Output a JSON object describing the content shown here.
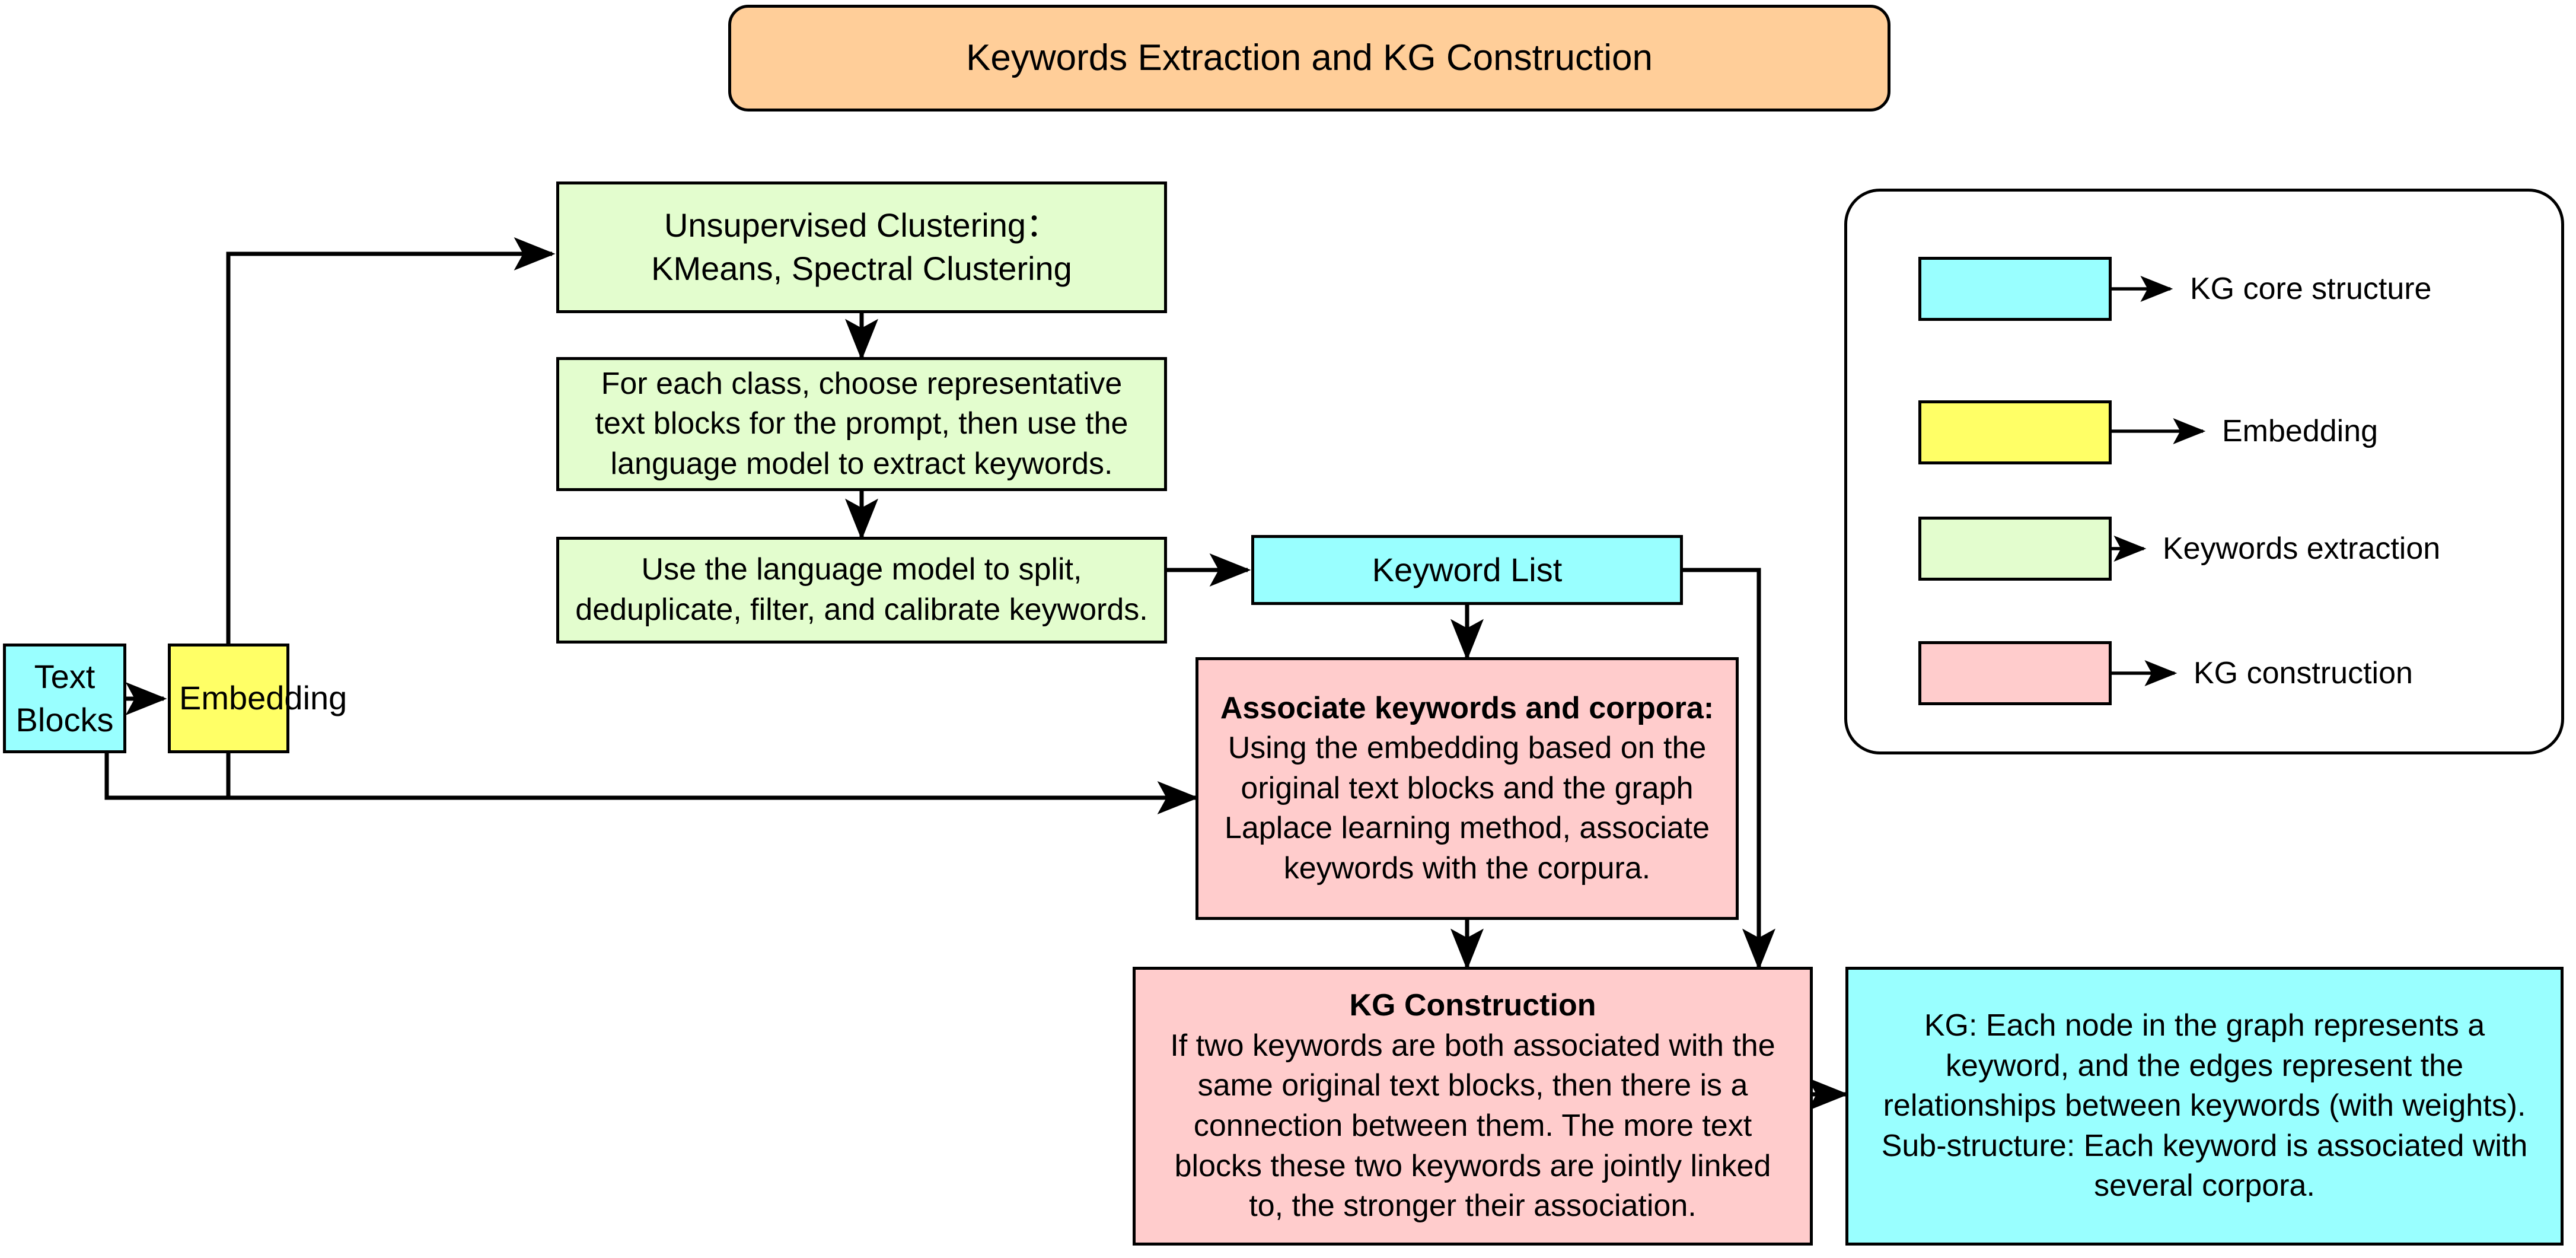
{
  "title": {
    "text": "Keywords Extraction and KG Construction"
  },
  "nodes": {
    "text_blocks": {
      "label": "Text Blocks",
      "color": "#99ffff",
      "category": "KG core structure"
    },
    "embedding": {
      "label": "Embedding",
      "color": "#ffff66",
      "category": "Embedding"
    },
    "clustering": {
      "line1": "Unsupervised Clustering：",
      "line2": "KMeans, Spectral Clustering",
      "color": "#e3fdce",
      "category": "Keywords extraction"
    },
    "representative": {
      "line1": "For each class, choose representative",
      "line2": "text blocks for the prompt, then use the",
      "line3": "language model to extract keywords.",
      "color": "#e3fdce",
      "category": "Keywords extraction"
    },
    "split_dedup": {
      "line1": "Use the language model to split,",
      "line2": "deduplicate, filter, and calibrate keywords.",
      "color": "#e3fdce",
      "category": "Keywords extraction"
    },
    "keyword_list": {
      "label": "Keyword List",
      "color": "#99ffff",
      "category": "KG core structure"
    },
    "associate": {
      "heading": "Associate keywords and corpora:",
      "line1": "Using the embedding based on the",
      "line2": "original text blocks and the graph",
      "line3": "Laplace learning method, associate",
      "line4": "keywords with the corpura.",
      "color": "#ffcccc",
      "category": "KG construction"
    },
    "kg_construction": {
      "heading": "KG Construction",
      "line1": "If two keywords are both associated with the",
      "line2": "same original text blocks, then there is a",
      "line3": "connection between them. The more text",
      "line4": "blocks these two keywords are jointly linked",
      "line5": "to, the stronger their association.",
      "color": "#ffcccc",
      "category": "KG construction"
    },
    "kg_result": {
      "line1": "KG: Each node in the graph represents a",
      "line2": "keyword, and the edges represent the",
      "line3": "relationships between keywords (with weights).",
      "line4": "Sub-structure: Each keyword is associated with",
      "line5": "several corpora.",
      "color": "#99ffff",
      "category": "KG core structure"
    }
  },
  "legend": {
    "items": [
      {
        "label": "KG core structure",
        "color": "#99ffff"
      },
      {
        "label": "Embedding",
        "color": "#ffff66"
      },
      {
        "label": "Keywords extraction",
        "color": "#e3fdce"
      },
      {
        "label": "KG construction",
        "color": "#ffcccc"
      }
    ]
  },
  "edges": [
    {
      "from": "text_blocks",
      "to": "embedding"
    },
    {
      "from": "embedding",
      "to": "clustering"
    },
    {
      "from": "clustering",
      "to": "representative"
    },
    {
      "from": "representative",
      "to": "split_dedup"
    },
    {
      "from": "split_dedup",
      "to": "keyword_list"
    },
    {
      "from": "keyword_list",
      "to": "associate"
    },
    {
      "from": "text_blocks",
      "to": "associate"
    },
    {
      "from": "embedding",
      "to": "associate"
    },
    {
      "from": "associate",
      "to": "kg_construction"
    },
    {
      "from": "keyword_list",
      "to": "kg_construction"
    },
    {
      "from": "kg_construction",
      "to": "kg_result"
    }
  ],
  "colors": {
    "stroke": "#000000",
    "background": "#ffffff",
    "title_fill": "#ffce99"
  }
}
